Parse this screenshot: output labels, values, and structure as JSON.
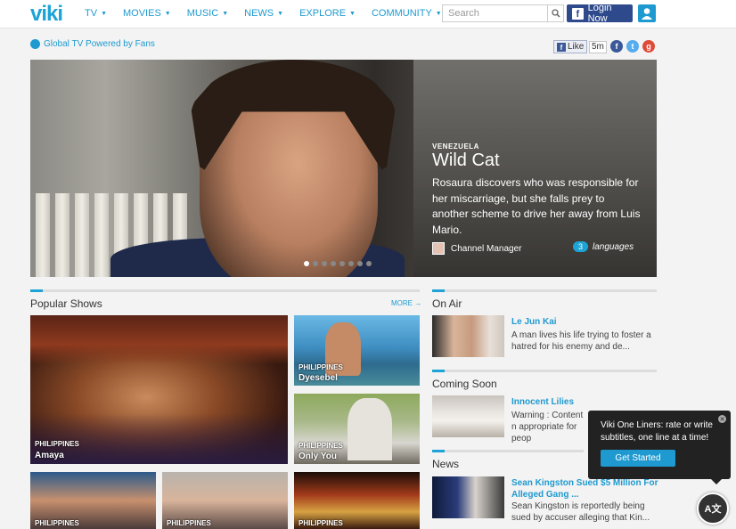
{
  "header": {
    "logo": "viki",
    "nav": [
      {
        "label": "TV"
      },
      {
        "label": "MOVIES"
      },
      {
        "label": "MUSIC"
      },
      {
        "label": "NEWS"
      },
      {
        "label": "EXPLORE"
      },
      {
        "label": "COMMUNITY"
      }
    ],
    "search_placeholder": "Search",
    "login_label": "Login Now"
  },
  "subbar": {
    "tagline": "Global TV Powered by Fans",
    "like_label": "Like",
    "like_count": "5m"
  },
  "hero": {
    "country": "VENEZUELA",
    "title": "Wild Cat",
    "description": "Rosaura discovers who was responsible for her miscarriage, but she falls prey to another scheme to drive her away from Luis Mario.",
    "channel": "Channel Manager",
    "languages_count": "3",
    "languages_label": "languages",
    "slides": 8,
    "active_slide": 1
  },
  "popular": {
    "heading": "Popular Shows",
    "more": "MORE",
    "tiles": [
      {
        "country": "PHILIPPINES",
        "name": "Amaya"
      },
      {
        "country": "PHILIPPINES",
        "name": "Dyesebel"
      },
      {
        "country": "PHILIPPINES",
        "name": "Only You"
      },
      {
        "country": "PHILIPPINES",
        "name": ""
      },
      {
        "country": "PHILIPPINES",
        "name": ""
      },
      {
        "country": "PHILIPPINES",
        "name": ""
      }
    ]
  },
  "on_air": {
    "heading": "On Air",
    "title": "Le Jun Kai",
    "desc": "A man lives his life trying to foster a hatred for his enemy and de..."
  },
  "coming_soon": {
    "heading": "Coming Soon",
    "title": "Innocent Lilies",
    "desc": "Warning : Content n appropriate for peop"
  },
  "news": {
    "heading": "News",
    "title": "Sean Kingston Sued $5 Million For Alleged Gang ...",
    "desc": "Sean Kingston is reportedly being sued by accuser alleging that Kin..."
  },
  "popup": {
    "text": "Viki One Liners: rate or write subtitles, one line at a time!",
    "button": "Get Started"
  },
  "colors": {
    "brand": "#1ea3d6",
    "facebook": "#2e4a8c"
  }
}
